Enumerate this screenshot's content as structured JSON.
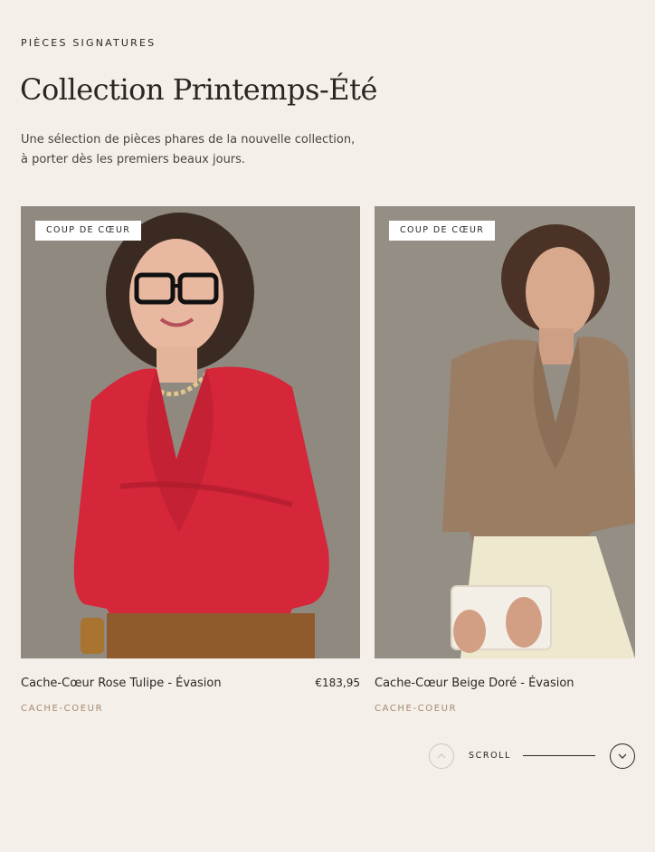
{
  "section": {
    "eyebrow": "PIÈCES SIGNATURES",
    "title": "Collection Printemps-Été",
    "intro": "Une sélection de pièces phares de la nouvelle collection, à porter dès les premiers beaux jours."
  },
  "products": [
    {
      "badge": "COUP DE CŒUR",
      "name": "Cache-Cœur Rose Tulipe - Évasion",
      "price": "€183,95",
      "category": "CACHE-COEUR",
      "top_color": "#d5263a"
    },
    {
      "badge": "COUP DE CŒUR",
      "name": "Cache-Cœur Beige Doré - Évasion",
      "category": "CACHE-COEUR",
      "top_color": "#9a7d63"
    }
  ],
  "scroll": {
    "label": "SCROLL",
    "up_icon": "chevron-up-icon",
    "down_icon": "chevron-down-icon"
  },
  "colors": {
    "background": "#f4efe8",
    "accent": "#a78a6f"
  }
}
